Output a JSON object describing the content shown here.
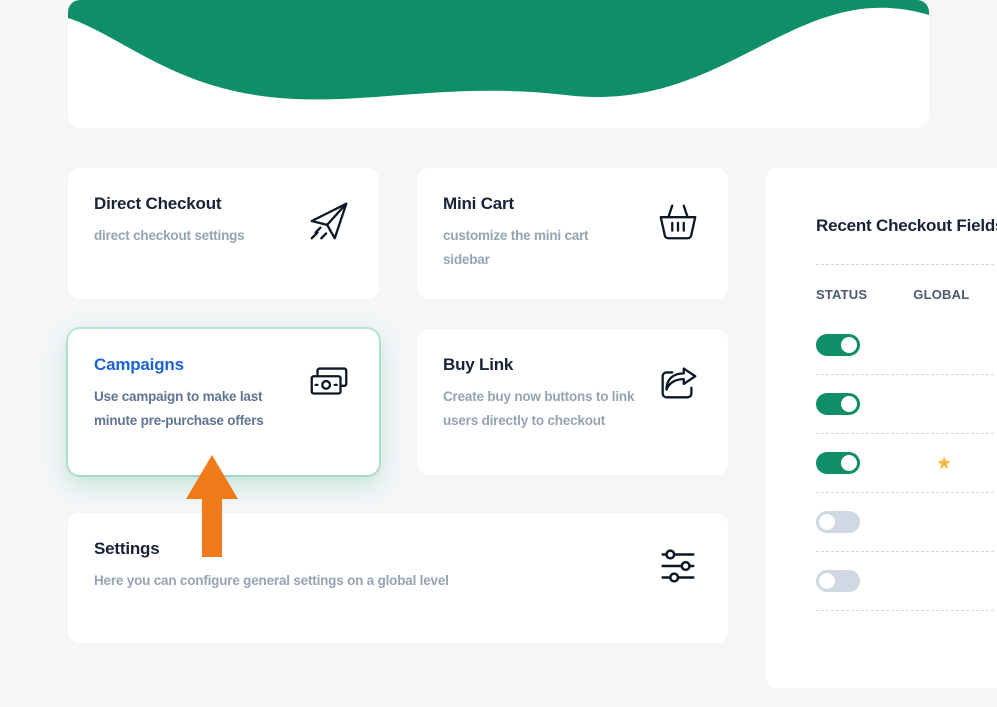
{
  "cards": {
    "direct_checkout": {
      "title": "Direct Checkout",
      "desc": "direct checkout settings"
    },
    "mini_cart": {
      "title": "Mini Cart",
      "desc": "customize the mini cart sidebar"
    },
    "campaigns": {
      "title": "Campaigns",
      "desc": "Use campaign to make last minute pre-purchase offers"
    },
    "buy_link": {
      "title": "Buy Link",
      "desc": "Create buy now buttons to link users directly to checkout"
    },
    "settings": {
      "title": "Settings",
      "desc": "Here you can configure general settings on a global level"
    }
  },
  "panel": {
    "title": "Recent Checkout Fields",
    "col_status": "STATUS",
    "col_global": "GLOBAL",
    "rows": [
      {
        "status_on": true,
        "global": ""
      },
      {
        "status_on": true,
        "global": ""
      },
      {
        "status_on": true,
        "global": "star"
      },
      {
        "status_on": false,
        "global": ""
      },
      {
        "status_on": false,
        "global": ""
      }
    ]
  },
  "colors": {
    "accent": "#0f8f67",
    "link": "#1e63d6",
    "arrow": "#f07b1b"
  }
}
